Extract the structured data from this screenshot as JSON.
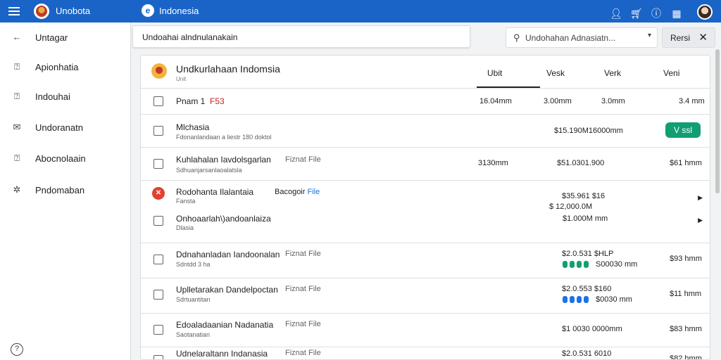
{
  "topbar": {
    "app_name": "Unobota",
    "region": "Indonesia",
    "globe_icon": "e",
    "icons": [
      "person-icon",
      "cart-icon",
      "info-icon",
      "grid-icon"
    ]
  },
  "sidebar": {
    "items": [
      {
        "label": "Untagar",
        "icon": "arrow-left-icon",
        "glyph": "←"
      },
      {
        "label": "Apionhatia",
        "icon": "document-icon",
        "glyph": "⍰"
      },
      {
        "label": "Indouhai",
        "icon": "document-icon",
        "glyph": "⍰"
      },
      {
        "label": "Undoranatn",
        "icon": "mail-icon",
        "glyph": "✉"
      },
      {
        "label": "Abocnolaain",
        "icon": "document-icon",
        "glyph": "⍰"
      },
      {
        "label": "Pndomaban",
        "icon": "gear-icon",
        "glyph": "✲"
      }
    ],
    "help_glyph": "?"
  },
  "search": {
    "main_value": "Undoahai alndnulanakain",
    "side_placeholder": "Undohahan Adnasiatn...",
    "reset_label": "Rersi",
    "reset_close": "✕"
  },
  "panel": {
    "title": "Undkurlahaan Indomsia",
    "subtitle": "Unit",
    "columns": [
      "Ubit",
      "Vesk",
      "Verk",
      "Veni"
    ]
  },
  "rows": [
    {
      "name": "Pnam 1",
      "name_red": "F53",
      "vals": [
        "16.04mm",
        "3.00mm",
        "3.0mm",
        "3.4 mm"
      ]
    },
    {
      "name": "Mlchasia",
      "sub": "Fdonanlandaan a liestr 180 doktol",
      "vals": [
        "$15.190M16000mm"
      ],
      "pill": "V ssl"
    },
    {
      "name": "Kuhlahalan Iavdolsgarlan",
      "tag": "Fiznat File",
      "sub": "Sdhuanjarsanlaoalatsla",
      "vals": [
        "3130mm",
        "$51.0301.900",
        "$61 hmm"
      ]
    },
    {
      "name": "Rodohanta Ilalantaia",
      "tag2": "Bacogoir",
      "tag2b": "File",
      "sub": "Fansta",
      "vals": [
        "$35.961 $16",
        "$ 12,000.0M"
      ],
      "error": "✕"
    },
    {
      "name": "Onhoaarlah\\)andoanlaiza",
      "sub": "Dlasia",
      "vals": [
        "$1.000M mm"
      ]
    },
    {
      "name": "Ddnahanladan Iandoonalan",
      "tag": "Fiznat File",
      "sub": "Sdntdd 3 ha",
      "vals": [
        "$2.0.531 $HLP",
        "S00030 mm",
        "$93 hmm"
      ]
    },
    {
      "name": "Uplletarakan Dandelpoctan",
      "tag": "Fiznat File",
      "sub": "Sdrtuantitan",
      "vals": [
        "$2.0.553 $160",
        "$0030 mm",
        "$11 hmm"
      ]
    },
    {
      "name": "Edoaladaanian Nadanatia",
      "tag": "Fiznat File",
      "sub": "Saotanatian",
      "vals": [
        "$1 0030 0000mm",
        "$83 hmm"
      ]
    },
    {
      "name": "Udnelaraltann Indanasia",
      "tag": "Fiznat File",
      "sub": "",
      "vals": [
        "$2.0.531 6010",
        "$82 hmm"
      ]
    }
  ],
  "colors": {
    "topbar": "#1a64c8",
    "accent_green": "#129e73",
    "error_red": "#e2412c",
    "value_red": "#c5221f",
    "link_blue": "#1a73e8"
  }
}
